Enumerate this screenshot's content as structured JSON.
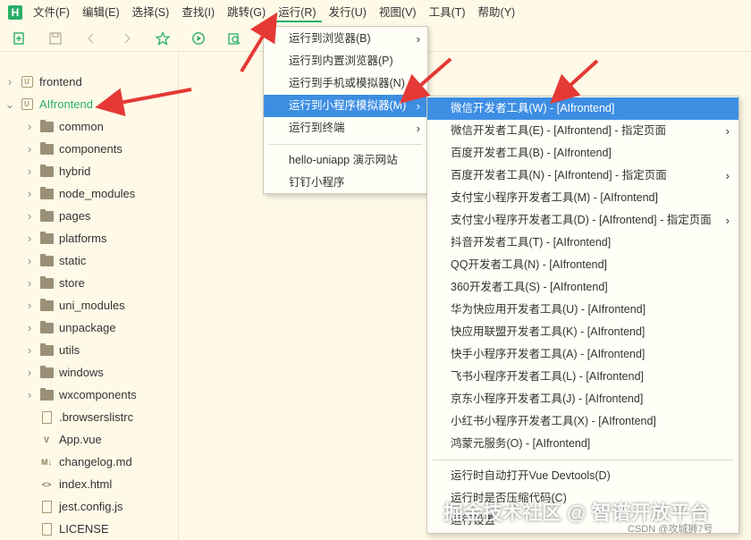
{
  "menubar": {
    "logo": "H",
    "items": [
      "文件(F)",
      "编辑(E)",
      "选择(S)",
      "查找(I)",
      "跳转(G)",
      "运行(R)",
      "发行(U)",
      "视图(V)",
      "工具(T)",
      "帮助(Y)"
    ],
    "active_index": 5
  },
  "toolbar": {
    "icons": [
      "new-file-icon",
      "save-icon",
      "back-icon",
      "forward-icon",
      "star-icon",
      "run-icon",
      "preview-icon"
    ]
  },
  "sidebar": {
    "items": [
      {
        "label": "frontend",
        "type": "project",
        "expanded": false,
        "level": 0
      },
      {
        "label": "AIfrontend",
        "type": "project",
        "expanded": true,
        "level": 0,
        "selected": true
      },
      {
        "label": "common",
        "type": "folder",
        "level": 1
      },
      {
        "label": "components",
        "type": "folder",
        "level": 1
      },
      {
        "label": "hybrid",
        "type": "folder",
        "level": 1
      },
      {
        "label": "node_modules",
        "type": "folder",
        "level": 1
      },
      {
        "label": "pages",
        "type": "folder",
        "level": 1
      },
      {
        "label": "platforms",
        "type": "folder",
        "level": 1
      },
      {
        "label": "static",
        "type": "folder",
        "level": 1
      },
      {
        "label": "store",
        "type": "folder",
        "level": 1
      },
      {
        "label": "uni_modules",
        "type": "folder",
        "level": 1
      },
      {
        "label": "unpackage",
        "type": "folder",
        "level": 1
      },
      {
        "label": "utils",
        "type": "folder",
        "level": 1
      },
      {
        "label": "windows",
        "type": "folder",
        "level": 1
      },
      {
        "label": "wxcomponents",
        "type": "folder",
        "level": 1
      },
      {
        "label": ".browserslistrc",
        "type": "file",
        "level": 1
      },
      {
        "label": "App.vue",
        "type": "vue",
        "level": 1
      },
      {
        "label": "changelog.md",
        "type": "md",
        "level": 1
      },
      {
        "label": "index.html",
        "type": "html",
        "level": 1
      },
      {
        "label": "jest.config.js",
        "type": "js",
        "level": 1
      },
      {
        "label": "LICENSE",
        "type": "file",
        "level": 1
      }
    ]
  },
  "run_menu": {
    "items": [
      {
        "label": "运行到浏览器(B)",
        "submenu": true
      },
      {
        "label": "运行到内置浏览器(P)",
        "submenu": false
      },
      {
        "label": "运行到手机或模拟器(N)",
        "submenu": true
      },
      {
        "label": "运行到小程序模拟器(M)",
        "submenu": true,
        "highlighted": true
      },
      {
        "label": "运行到终端",
        "submenu": true
      },
      {
        "label": "hello-uniapp 演示网站",
        "submenu": false
      },
      {
        "label": "钉钉小程序",
        "submenu": false
      }
    ]
  },
  "mini_program_menu": {
    "items": [
      {
        "label": "微信开发者工具(W) - [AIfrontend]",
        "highlighted": true
      },
      {
        "label": "微信开发者工具(E) - [AIfrontend] - 指定页面",
        "submenu": true
      },
      {
        "label": "百度开发者工具(B) - [AIfrontend]"
      },
      {
        "label": "百度开发者工具(N) - [AIfrontend] - 指定页面",
        "submenu": true
      },
      {
        "label": "支付宝小程序开发者工具(M) - [AIfrontend]"
      },
      {
        "label": "支付宝小程序开发者工具(D) - [AIfrontend] - 指定页面",
        "submenu": true
      },
      {
        "label": "抖音开发者工具(T) - [AIfrontend]"
      },
      {
        "label": "QQ开发者工具(N) - [AIfrontend]"
      },
      {
        "label": "360开发者工具(S) - [AIfrontend]"
      },
      {
        "label": "华为快应用开发者工具(U) - [AIfrontend]"
      },
      {
        "label": "快应用联盟开发者工具(K) - [AIfrontend]"
      },
      {
        "label": "快手小程序开发者工具(A) - [AIfrontend]"
      },
      {
        "label": "飞书小程序开发者工具(L) - [AIfrontend]"
      },
      {
        "label": "京东小程序开发者工具(J) - [AIfrontend]"
      },
      {
        "label": "小红书小程序开发者工具(X) - [AIfrontend]"
      },
      {
        "label": "鸿蒙元服务(O) - [AIfrontend]"
      },
      {
        "label": "运行时自动打开Vue Devtools(D)"
      },
      {
        "label": "运行时是否压缩代码(C)"
      },
      {
        "label": "运行设置"
      }
    ]
  },
  "watermark": {
    "text": "掘金技术社区 @ 智谱开放平台",
    "sub": "CSDN @攻城狮7号"
  },
  "colors": {
    "background": "#fffae8",
    "accent_green": "#2aae67",
    "highlight_blue": "#3d8ee3",
    "annotation_red": "#e53935"
  }
}
